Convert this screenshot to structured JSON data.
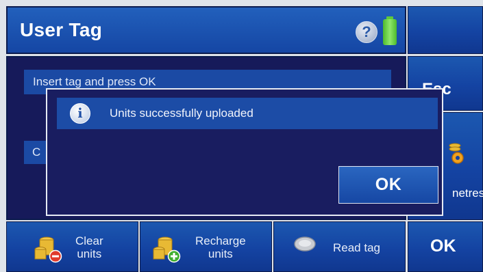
{
  "header": {
    "title": "User Tag",
    "help_icon": "help-icon",
    "battery_icon": "battery-icon",
    "help_glyph": "?"
  },
  "side_buttons": {
    "esc_label": "Esc",
    "params_label": "netres",
    "params_icon": "gear-coins-icon"
  },
  "main": {
    "instruction": "Insert tag and press OK",
    "second_line": "C"
  },
  "dialog": {
    "info_glyph": "i",
    "message": "Units successfully uploaded",
    "ok_label": "OK"
  },
  "bottom_buttons": {
    "clear": {
      "line1": "Clear",
      "line2": "units",
      "icon": "coins-remove-icon"
    },
    "recharge": {
      "line1": "Recharge",
      "line2": "units",
      "icon": "coins-add-icon"
    },
    "read": {
      "label": "Read tag",
      "icon": "tag-icon"
    },
    "ok_label": "OK"
  },
  "colors": {
    "button_blue": "#1443a2",
    "panel_navy": "#161a5a",
    "battery_green": "#5ec93a",
    "coin_gold": "#e8b934"
  }
}
